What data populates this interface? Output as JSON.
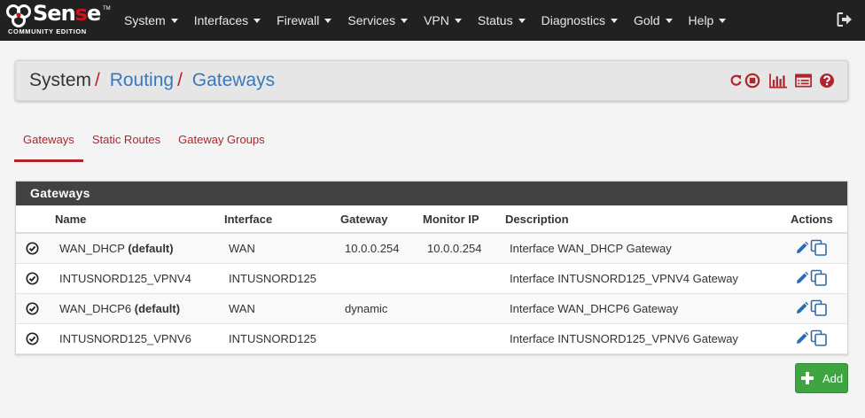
{
  "brand": {
    "word_a": "Sen",
    "word_s": "s",
    "word_b": "e",
    "tm": "TM",
    "edition": "COMMUNITY EDITION"
  },
  "nav": {
    "items": [
      {
        "label": "System"
      },
      {
        "label": "Interfaces"
      },
      {
        "label": "Firewall"
      },
      {
        "label": "Services"
      },
      {
        "label": "VPN"
      },
      {
        "label": "Status"
      },
      {
        "label": "Diagnostics"
      },
      {
        "label": "Gold"
      },
      {
        "label": "Help"
      }
    ],
    "logout_icon": "sign-out-icon"
  },
  "breadcrumb": {
    "root": "System",
    "sep": "/",
    "level1": "Routing",
    "level2": "Gateways",
    "icons": [
      "restart-icon",
      "stop-icon",
      "bar-chart-icon",
      "log-list-icon",
      "help-icon"
    ]
  },
  "tabs": [
    {
      "label": "Gateways",
      "active": true
    },
    {
      "label": "Static Routes",
      "active": false
    },
    {
      "label": "Gateway Groups",
      "active": false
    }
  ],
  "panel": {
    "title": "Gateways",
    "columns": {
      "name": "Name",
      "interface": "Interface",
      "gateway": "Gateway",
      "monitor": "Monitor IP",
      "description": "Description",
      "actions": "Actions"
    },
    "rows": [
      {
        "name": "WAN_DHCP",
        "default": "(default)",
        "interface": "WAN",
        "gateway": "10.0.0.254",
        "monitor": "10.0.0.254",
        "description": "Interface WAN_DHCP Gateway"
      },
      {
        "name": "INTUSNORD125_VPNV4",
        "default": "",
        "interface": "INTUSNORD125",
        "gateway": "",
        "monitor": "",
        "description": "Interface INTUSNORD125_VPNV4 Gateway"
      },
      {
        "name": "WAN_DHCP6",
        "default": "(default)",
        "interface": "WAN",
        "gateway": "dynamic",
        "monitor": "",
        "description": "Interface WAN_DHCP6 Gateway"
      },
      {
        "name": "INTUSNORD125_VPNV6",
        "default": "",
        "interface": "INTUSNORD125",
        "gateway": "",
        "monitor": "",
        "description": "Interface INTUSNORD125_VPNV6 Gateway"
      }
    ]
  },
  "add_button": {
    "label": "Add"
  },
  "colors": {
    "accent_red": "#b0252c",
    "link_blue": "#3c78b8",
    "add_green": "#3fa442",
    "navbar": "#212121",
    "panel_head": "#424242",
    "action_blue": "#2b6cb0"
  }
}
